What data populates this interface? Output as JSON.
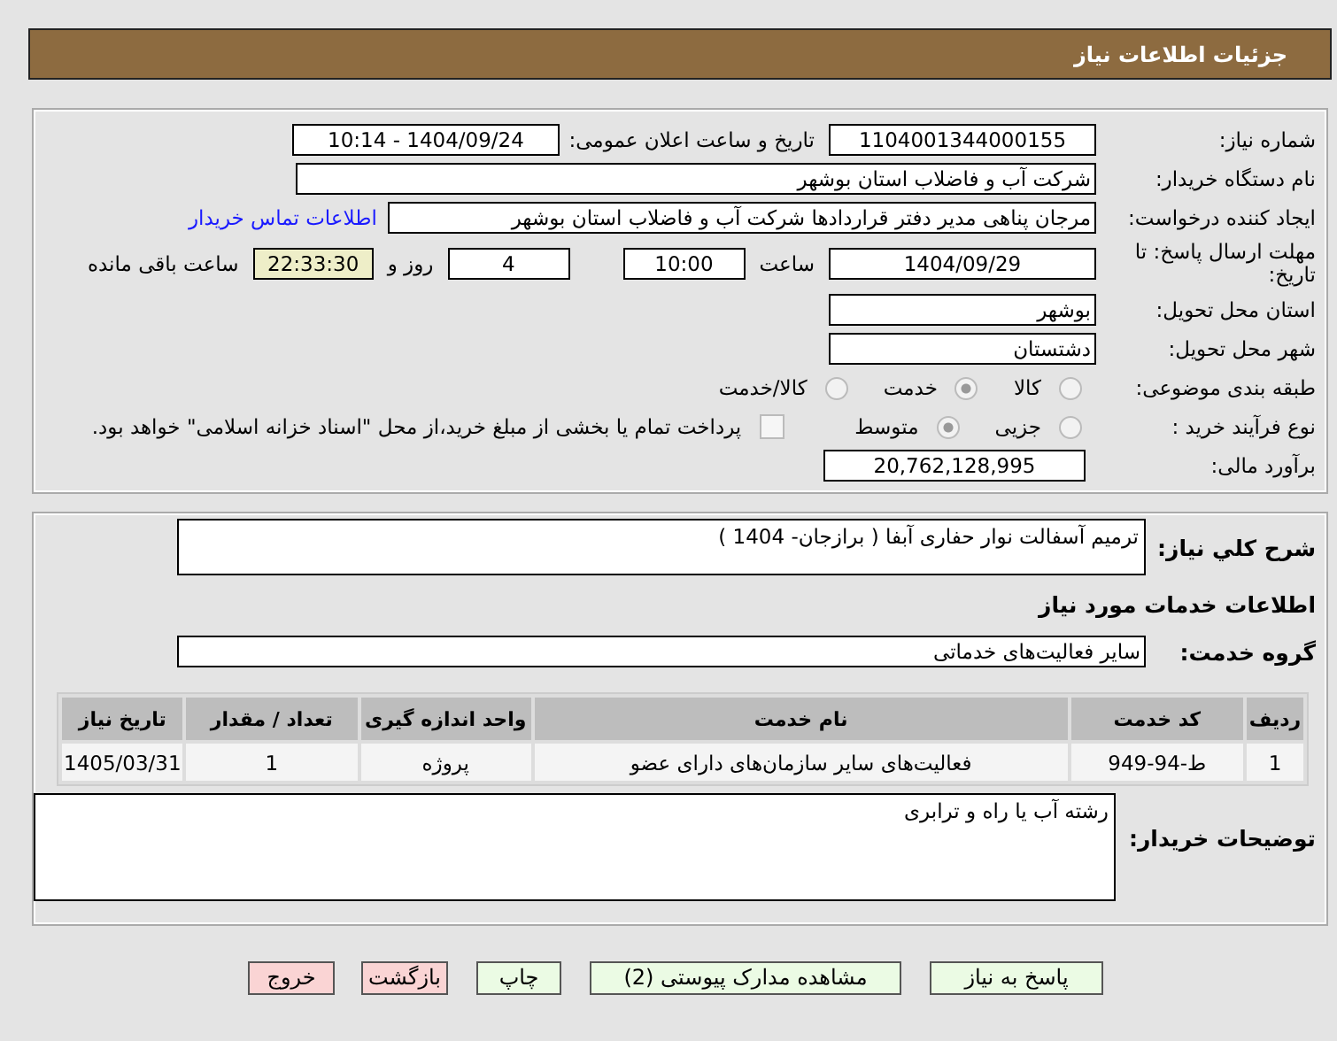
{
  "header": {
    "title": "جزئیات اطلاعات نیاز"
  },
  "details": {
    "need_number": {
      "label": "شماره نیاز:",
      "value": "1104001344000155"
    },
    "announce": {
      "label": "تاریخ و ساعت اعلان عمومی:",
      "value": "1404/09/24 - 10:14"
    },
    "buyer": {
      "label": "نام دستگاه خریدار:",
      "value": "شرکت آب و فاضلاب استان بوشهر"
    },
    "creator": {
      "label": "ایجاد کننده درخواست:",
      "value": "مرجان پناهی مدیر دفتر قراردادها شرکت آب و فاضلاب استان بوشهر",
      "link": "اطلاعات تماس خریدار"
    },
    "deadline": {
      "label": "مهلت ارسال پاسخ: تا تاریخ:",
      "date": "1404/09/29",
      "time_label": "ساعت",
      "time": "10:00",
      "days": "4",
      "days_label": "روز و",
      "remaining": "22:33:30",
      "remaining_label": "ساعت باقی مانده"
    },
    "province": {
      "label": "استان محل تحویل:",
      "value": "بوشهر"
    },
    "city": {
      "label": "شهر محل تحویل:",
      "value": "دشتستان"
    },
    "category": {
      "label": "طبقه بندی موضوعی:",
      "options": [
        {
          "label": "کالا",
          "selected": false
        },
        {
          "label": "خدمت",
          "selected": true
        },
        {
          "label": "کالا/خدمت",
          "selected": false
        }
      ]
    },
    "process": {
      "label": "نوع فرآیند خرید :",
      "options": [
        {
          "label": "جزیی",
          "selected": false
        },
        {
          "label": "متوسط",
          "selected": true
        }
      ],
      "payment": {
        "checked": false,
        "text": "پرداخت تمام یا بخشی از مبلغ خرید،از محل \"اسناد خزانه اسلامی\" خواهد بود."
      }
    },
    "estimate": {
      "label": "برآورد مالی:",
      "value": "20,762,128,995"
    }
  },
  "needs": {
    "description_label": "شرح کلي نیاز:",
    "description": "ترمیم آسفالت نوار حفاری آبفا ( برازجان- 1404 )",
    "services_heading": "اطلاعات خدمات مورد نیاز",
    "group_label": "گروه خدمت:",
    "group": "سایر فعالیت‌های خدماتی",
    "table": {
      "columns": [
        "ردیف",
        "کد خدمت",
        "نام خدمت",
        "واحد اندازه گیری",
        "تعداد / مقدار",
        "تاریخ نیاز"
      ],
      "rows": [
        [
          "1",
          "ط-94-949",
          "فعالیت‌های سایر سازمان‌های دارای عضو",
          "پروژه",
          "1",
          "1405/03/31"
        ]
      ]
    },
    "notes_label": "توضیحات خریدار:",
    "notes": "رشته آب یا راه و ترابری"
  },
  "buttons": [
    {
      "label": "پاسخ به نیاز",
      "kind": "normal"
    },
    {
      "label": "مشاهده مدارک پیوستی (2)",
      "kind": "normal"
    },
    {
      "label": "چاپ",
      "kind": "normal"
    },
    {
      "label": "بازگشت",
      "kind": "danger"
    },
    {
      "label": "خروج",
      "kind": "danger"
    }
  ]
}
